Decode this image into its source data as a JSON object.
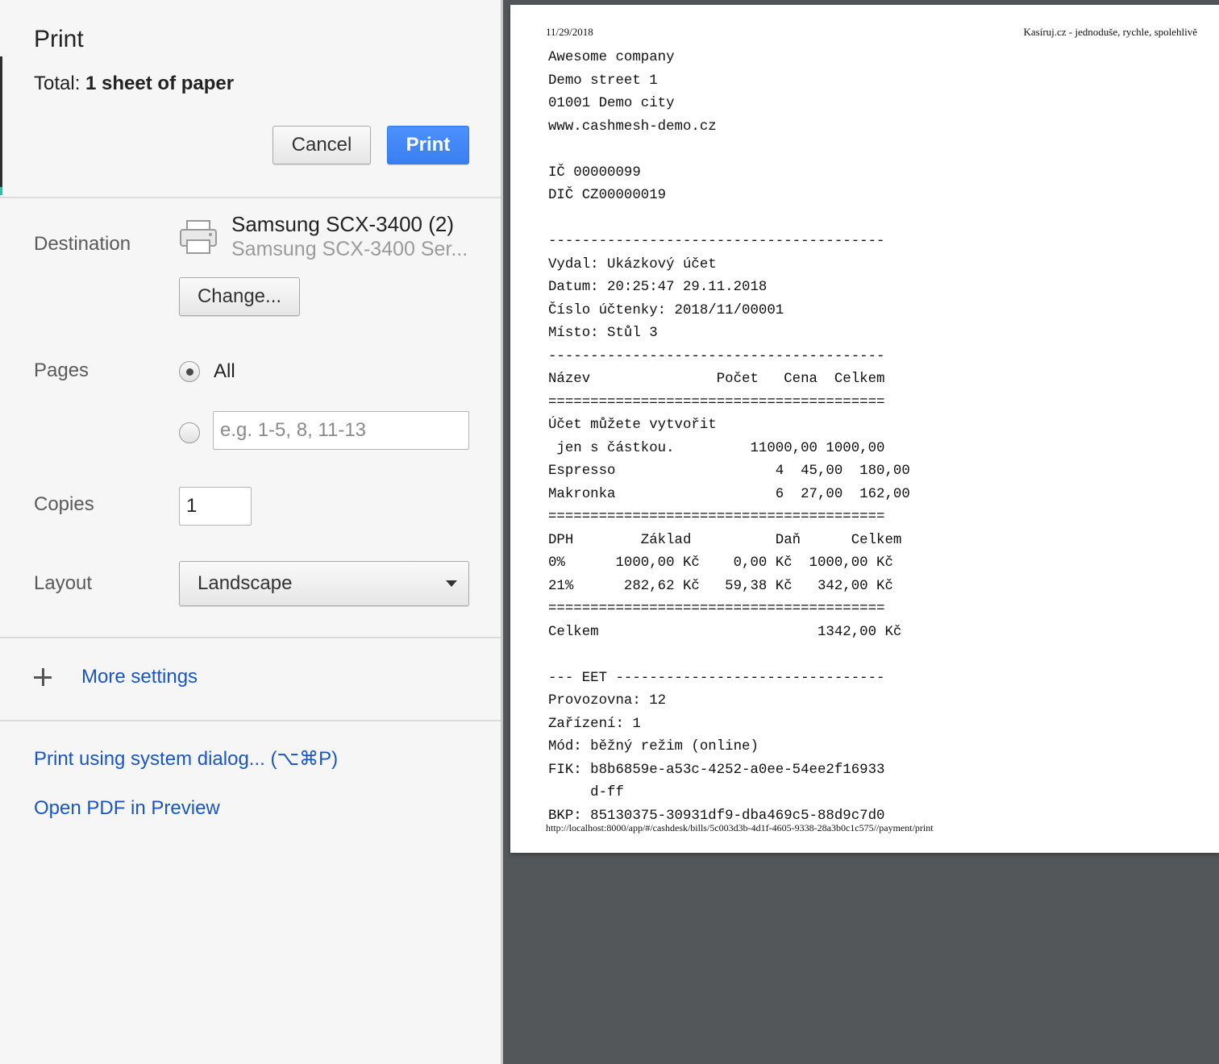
{
  "dialog": {
    "title": "Print",
    "total_prefix": "Total: ",
    "total_value": "1 sheet of paper",
    "cancel_label": "Cancel",
    "print_label": "Print"
  },
  "destination": {
    "label": "Destination",
    "printer_name": "Samsung SCX-3400 (2)",
    "printer_sub": "Samsung SCX-3400 Ser...",
    "change_label": "Change..."
  },
  "pages": {
    "label": "Pages",
    "all_label": "All",
    "range_placeholder": "e.g. 1-5, 8, 11-13",
    "selected": "all"
  },
  "copies": {
    "label": "Copies",
    "value": "1"
  },
  "layout": {
    "label": "Layout",
    "value": "Landscape"
  },
  "more_settings": {
    "label": "More settings"
  },
  "links": {
    "system_dialog": "Print using system dialog... (⌥⌘P)",
    "open_pdf": "Open PDF in Preview"
  },
  "preview": {
    "header_date": "11/29/2018",
    "header_title": "Kasíruj.cz - jednoduše, rychle, spolehlivě",
    "footer_url": "http://localhost:8000/app/#/cashdesk/bills/5c003d3b-4d1f-4605-9338-28a3b0c1c575//payment/print",
    "receipt_lines": [
      "Awesome company",
      "Demo street 1",
      "01001 Demo city",
      "www.cashmesh-demo.cz",
      "",
      "IČ 00000099",
      "DIČ CZ00000019",
      "",
      "----------------------------------------",
      "Vydal: Ukázkový účet",
      "Datum: 20:25:47 29.11.2018",
      "Číslo účtenky: 2018/11/00001",
      "Místo: Stůl 3",
      "----------------------------------------",
      "Název               Počet   Cena  Celkem",
      "========================================",
      "Účet můžete vytvořit",
      " jen s částkou.         11000,00 1000,00",
      "Espresso                   4  45,00  180,00",
      "Makronka                   6  27,00  162,00",
      "========================================",
      "DPH        Základ          Daň      Celkem",
      "0%      1000,00 Kč    0,00 Kč  1000,00 Kč",
      "21%      282,62 Kč   59,38 Kč   342,00 Kč",
      "========================================",
      "Celkem                          1342,00 Kč",
      "",
      "--- EET --------------------------------",
      "Provozovna: 12",
      "Zařízení: 1",
      "Mód: běžný režim (online)",
      "FIK: b8b6859e-a53c-4252-a0ee-54ee2f16933",
      "     d-ff",
      "BKP: 85130375-30931df9-dba469c5-88d9c7d0"
    ]
  }
}
